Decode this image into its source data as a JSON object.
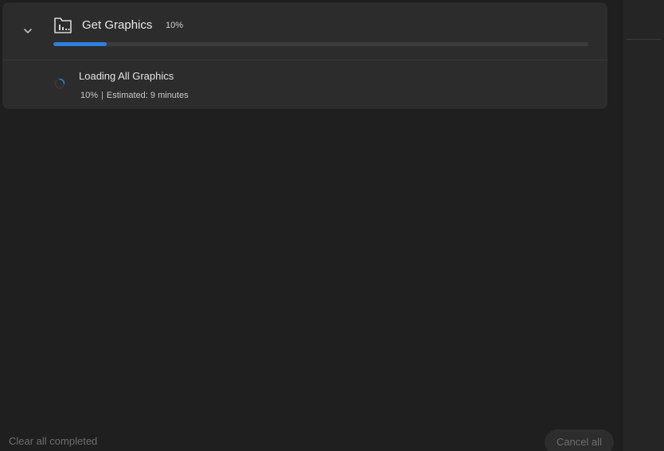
{
  "job": {
    "title": "Get Graphics",
    "percent_label": "10%",
    "progress": 0.1,
    "expand_icon": "chevron-down-icon",
    "type_icon": "folder-chart-icon"
  },
  "task": {
    "title": "Loading All Graphics",
    "percent_label": "10%",
    "separator": "|",
    "estimate": "Estimated: 9 minutes",
    "status_icon": "spinner-icon"
  },
  "footer": {
    "clear_label": "Clear all completed",
    "cancel_label": "Cancel all"
  },
  "colors": {
    "background": "#1f1f1f",
    "panel": "#2c2c2c",
    "progress_fill": "#2e7ee0",
    "progress_track": "#3c3c3c",
    "disabled_text": "#6e6e6e"
  }
}
